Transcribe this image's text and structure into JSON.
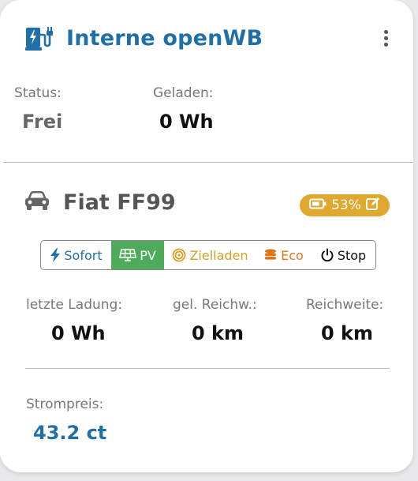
{
  "colors": {
    "accent": "#1f6fa8",
    "pv_green": "#4fab5c",
    "ziel_gold": "#d7a025",
    "eco_orange": "#e0741d",
    "soc_badge": "#e0a82e"
  },
  "header": {
    "title": "Interne openWB",
    "icon": "charging-station-icon",
    "menu_icon": "more-vertical-icon"
  },
  "status": {
    "status_label": "Status:",
    "status_value": "Frei",
    "charged_label": "Geladen:",
    "charged_value": "0 Wh"
  },
  "vehicle": {
    "icon": "car-icon",
    "name": "Fiat FF99",
    "soc": "53%",
    "soc_icons": [
      "battery-icon",
      "edit-icon"
    ]
  },
  "modes": [
    {
      "label": "Sofort",
      "icon": "bolt-icon"
    },
    {
      "label": "PV",
      "icon": "solar-panel-icon",
      "active": true
    },
    {
      "label": "Zielladen",
      "icon": "target-icon"
    },
    {
      "label": "Eco",
      "icon": "coins-icon"
    },
    {
      "label": "Stop",
      "icon": "power-icon"
    }
  ],
  "stats": {
    "last_charge_label": "letzte Ladung:",
    "last_charge_value": "0 Wh",
    "range_charged_label": "gel. Reichw.:",
    "range_charged_value": "0 km",
    "range_label": "Reichweite:",
    "range_value": "0 km"
  },
  "price": {
    "label": "Strompreis:",
    "value": "43.2 ct"
  }
}
